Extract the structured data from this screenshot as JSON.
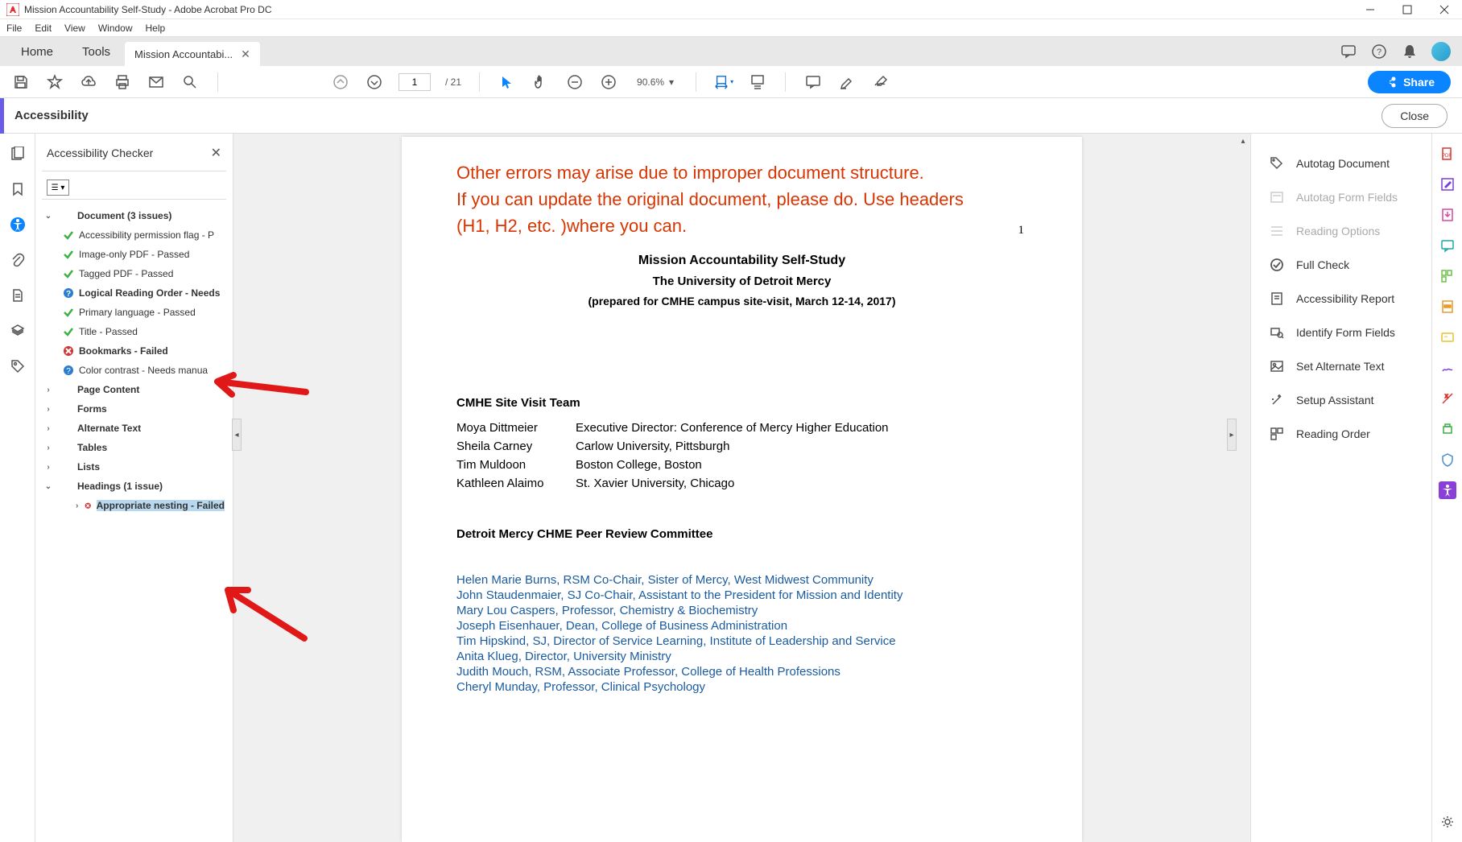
{
  "window_title": "Mission Accountability Self-Study - Adobe Acrobat Pro DC",
  "menu": {
    "file": "File",
    "edit": "Edit",
    "view": "View",
    "window": "Window",
    "help": "Help"
  },
  "tabs": {
    "home": "Home",
    "tools": "Tools",
    "doc": "Mission Accountabi..."
  },
  "toolbar": {
    "page_current": "1",
    "page_total": "/ 21",
    "zoom": "90.6%",
    "share_label": "Share"
  },
  "subheader": {
    "title": "Accessibility",
    "close": "Close"
  },
  "checker": {
    "title": "Accessibility Checker",
    "groups": {
      "document": "Document (3 issues)",
      "page_content": "Page Content",
      "forms": "Forms",
      "alt_text": "Alternate Text",
      "tables": "Tables",
      "lists": "Lists",
      "headings": "Headings (1 issue)"
    },
    "items": {
      "perm": "Accessibility permission flag - P",
      "image_only": "Image-only PDF - Passed",
      "tagged": "Tagged PDF - Passed",
      "reading_order": "Logical Reading Order - Needs",
      "lang": "Primary language - Passed",
      "title": "Title - Passed",
      "bookmarks": "Bookmarks - Failed",
      "contrast": "Color contrast - Needs manua",
      "nesting": "Appropriate nesting - Failed"
    }
  },
  "overlay": {
    "line1": "Other errors may arise due to improper document structure.",
    "line2": "If you can update the original document, please do. Use headers",
    "line3": " (H1, H2, etc. )where you can."
  },
  "document_body": {
    "page_num": "1",
    "title": "Mission Accountability Self-Study",
    "subtitle": "The University of Detroit Mercy",
    "prepared": "(prepared for CMHE campus site-visit, March 12-14, 2017)",
    "site_team_h": "CMHE Site Visit Team",
    "team": [
      {
        "name": "Moya Dittmeier",
        "role": "Executive Director:  Conference of Mercy Higher Education"
      },
      {
        "name": "Sheila Carney",
        "role": "Carlow University,   Pittsburgh"
      },
      {
        "name": "Tim Muldoon",
        "role": "Boston College,  Boston"
      },
      {
        "name": "Kathleen Alaimo",
        "role": "St. Xavier University, Chicago"
      }
    ],
    "peer_h": "Detroit Mercy CHME Peer Review Committee",
    "committee": [
      "Helen Marie Burns, RSM Co-Chair,  Sister of Mercy, West Midwest Community",
      "John Staudenmaier, SJ Co-Chair, Assistant to the President for Mission and Identity",
      "Mary Lou Caspers, Professor, Chemistry & Biochemistry",
      "Joseph Eisenhauer, Dean,  College of Business Administration",
      "Tim Hipskind, SJ,  Director of Service Learning, Institute of Leadership and Service",
      "Anita Klueg,  Director,   University Ministry",
      "Judith Mouch, RSM, Associate Professor, College of Health Professions",
      "Cheryl Munday,  Professor, Clinical Psychology"
    ]
  },
  "right_panel": {
    "autotag_doc": "Autotag Document",
    "autotag_form": "Autotag Form Fields",
    "reading_opts": "Reading Options",
    "full_check": "Full Check",
    "acc_report": "Accessibility Report",
    "identify_form": "Identify Form Fields",
    "set_alt": "Set Alternate Text",
    "setup": "Setup Assistant",
    "reading_order": "Reading Order"
  }
}
